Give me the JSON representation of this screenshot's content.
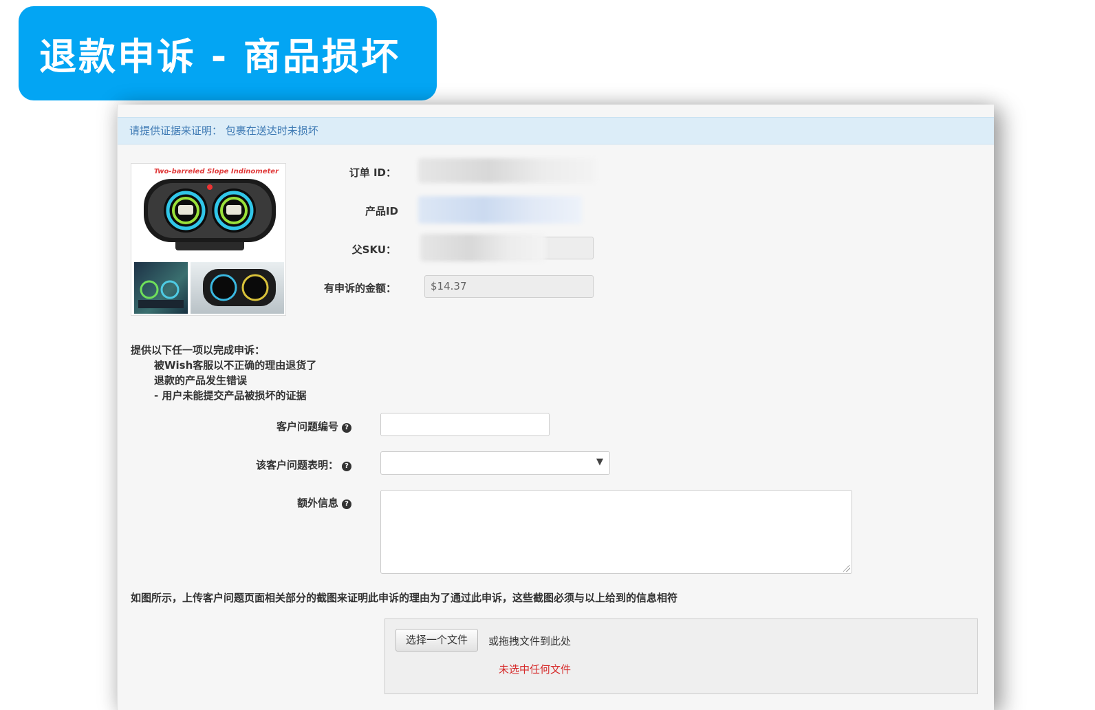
{
  "banner": {
    "title": "退款申诉 - 商品损坏"
  },
  "panel": {
    "header_text": "请提供证据来证明： 包裹在送达时未损坏"
  },
  "product_image": {
    "caption": "Two-barreled Slope Indinometer"
  },
  "fields": {
    "order_id_label": "订单 ID：",
    "product_id_label": "产品ID",
    "parent_sku_label": "父SKU：",
    "amount_label": "有申诉的金额：",
    "amount_value": "$14.37"
  },
  "requirements": {
    "heading": "提供以下任一项以完成申诉：",
    "items": [
      "被Wish客服以不正确的理由退货了",
      "退款的产品发生错误",
      "- 用户未能提交产品被损坏的证据"
    ]
  },
  "form": {
    "ticket_label": "客户问题编号",
    "ticket_value": "",
    "statement_label": "该客户问题表明：",
    "statement_value": "",
    "extra_label": "额外信息",
    "extra_value": "",
    "help_icon": "question-circle-icon"
  },
  "upload": {
    "instruction": "如图所示，上传客户问题页面相关部分的截图来证明此申诉的理由为了通过此申诉，这些截图必须与以上给到的信息相符",
    "choose_button": "选择一个文件",
    "drag_hint": "或拖拽文件到此处",
    "no_file": "未选中任何文件"
  },
  "colors": {
    "banner_blue": "#03a5f3",
    "header_bar": "#dcedf8",
    "header_text": "#3e7ab4",
    "error_red": "#d62a2a"
  }
}
